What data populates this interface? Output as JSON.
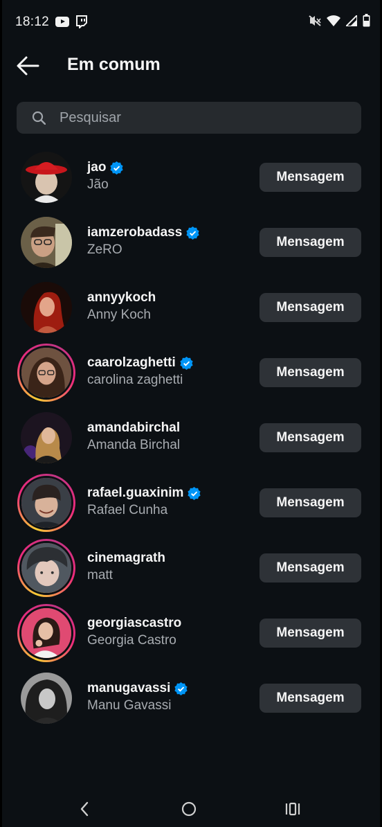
{
  "status_bar": {
    "time": "18:12",
    "left_icons": [
      "youtube-icon",
      "twitch-icon"
    ],
    "right_icons": [
      "mute-icon",
      "wifi-icon",
      "signal-icon",
      "battery-icon"
    ]
  },
  "header": {
    "title": "Em comum",
    "back_icon": "arrow-left-icon"
  },
  "search": {
    "placeholder": "Pesquisar",
    "value": ""
  },
  "users": [
    {
      "username": "jao",
      "full_name": "Jão",
      "verified": true,
      "story": false,
      "button": "Mensagem",
      "avatar_bg": "#b31b1b"
    },
    {
      "username": "iamzerobadass",
      "full_name": "ZeRO",
      "verified": true,
      "story": false,
      "button": "Mensagem",
      "avatar_bg": "#6b5a3e"
    },
    {
      "username": "annyykoch",
      "full_name": "Anny Koch",
      "verified": false,
      "story": false,
      "button": "Mensagem",
      "avatar_bg": "#5a1212"
    },
    {
      "username": "caarolzaghetti",
      "full_name": "carolina zaghetti",
      "verified": true,
      "story": true,
      "button": "Mensagem",
      "avatar_bg": "#5b4030"
    },
    {
      "username": "amandabirchal",
      "full_name": "Amanda Birchal",
      "verified": false,
      "story": false,
      "button": "Mensagem",
      "avatar_bg": "#2a1a2e"
    },
    {
      "username": "rafael.guaxinim",
      "full_name": "Rafael Cunha",
      "verified": true,
      "story": true,
      "button": "Mensagem",
      "avatar_bg": "#3a4048"
    },
    {
      "username": "cinemagrath",
      "full_name": "matt",
      "verified": false,
      "story": true,
      "button": "Mensagem",
      "avatar_bg": "#4a5258"
    },
    {
      "username": "georgiascastro",
      "full_name": "Georgia Castro",
      "verified": false,
      "story": true,
      "button": "Mensagem",
      "avatar_bg": "#d94a6e"
    },
    {
      "username": "manugavassi",
      "full_name": "Manu Gavassi",
      "verified": true,
      "story": false,
      "button": "Mensagem",
      "avatar_bg": "#8c8c8c"
    }
  ],
  "nav_bar": {
    "icons": [
      "back-nav-icon",
      "home-nav-icon",
      "recents-nav-icon"
    ]
  },
  "colors": {
    "background": "#0c1014",
    "verified_badge": "#0095f6",
    "button_bg": "#2e3237",
    "search_bg": "#262a2e"
  }
}
